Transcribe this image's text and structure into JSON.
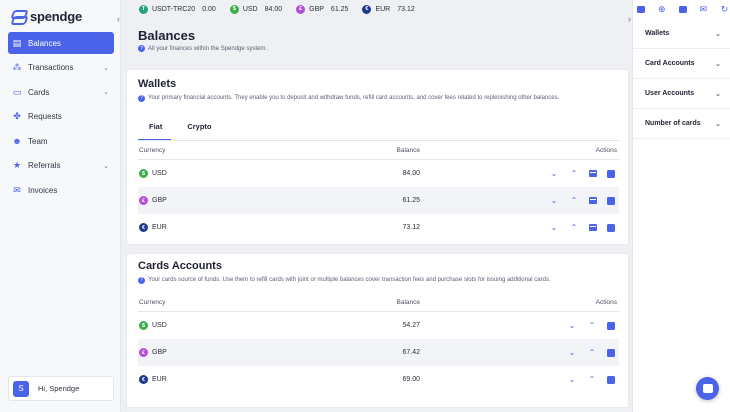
{
  "app": {
    "logo_text": "spendge"
  },
  "sidebar": {
    "items": [
      {
        "label": "Balances",
        "icon": "wallet-icon",
        "active": true,
        "chevron": false
      },
      {
        "label": "Transactions",
        "icon": "transactions-icon",
        "active": false,
        "chevron": true
      },
      {
        "label": "Cards",
        "icon": "card-icon",
        "active": false,
        "chevron": true
      },
      {
        "label": "Requests",
        "icon": "requests-icon",
        "active": false,
        "chevron": false
      },
      {
        "label": "Team",
        "icon": "team-icon",
        "active": false,
        "chevron": false
      },
      {
        "label": "Referrals",
        "icon": "star-icon",
        "active": false,
        "chevron": true
      },
      {
        "label": "Invoices",
        "icon": "mail-icon",
        "active": false,
        "chevron": false
      }
    ],
    "user": {
      "avatar_letter": "S",
      "greeting": "Hi, Spendge"
    }
  },
  "topbar": {
    "balances": [
      {
        "coin": "T",
        "name": "USDT-TRC20",
        "value": "0.00",
        "color": "#26a17b"
      },
      {
        "coin": "$",
        "name": "USD",
        "value": "84.00",
        "color": "#3cb048"
      },
      {
        "coin": "£",
        "name": "GBP",
        "value": "61.25",
        "color": "#b04fd6"
      },
      {
        "coin": "€",
        "name": "EUR",
        "value": "73.12",
        "color": "#1e3a8a"
      }
    ]
  },
  "page": {
    "title": "Balances",
    "subtitle": "All your finances within the Spendge system."
  },
  "wallets": {
    "title": "Wallets",
    "description": "Your primary financial accounts. They enable you to deposit and withdraw funds, refill card accounts, and cover fees related to replenishing other balances.",
    "tabs": [
      {
        "label": "Fiat",
        "active": true
      },
      {
        "label": "Crypto",
        "active": false
      }
    ],
    "columns": {
      "currency": "Currency",
      "balance": "Balance",
      "actions": "Actions"
    },
    "rows": [
      {
        "coin": "$",
        "currency": "USD",
        "balance": "84.00"
      },
      {
        "coin": "£",
        "currency": "GBP",
        "balance": "61.25"
      },
      {
        "coin": "€",
        "currency": "EUR",
        "balance": "73.12"
      }
    ]
  },
  "card_accounts": {
    "title": "Cards Accounts",
    "description": "Your cards source of funds. Use them to refill cards with joint or multiple balances cover transaction fees and purchase slots for issuing additional cards.",
    "columns": {
      "currency": "Currency",
      "balance": "Balance",
      "actions": "Actions"
    },
    "rows": [
      {
        "coin": "$",
        "currency": "USD",
        "balance": "54.27"
      },
      {
        "coin": "£",
        "currency": "GBP",
        "balance": "67.42"
      },
      {
        "coin": "€",
        "currency": "EUR",
        "balance": "69.00"
      }
    ]
  },
  "right_panel": {
    "sections": [
      {
        "label": "Wallets"
      },
      {
        "label": "Card Accounts"
      },
      {
        "label": "User Accounts"
      },
      {
        "label": "Number of cards"
      }
    ]
  },
  "colors": {
    "accent": "#4a63e8"
  }
}
